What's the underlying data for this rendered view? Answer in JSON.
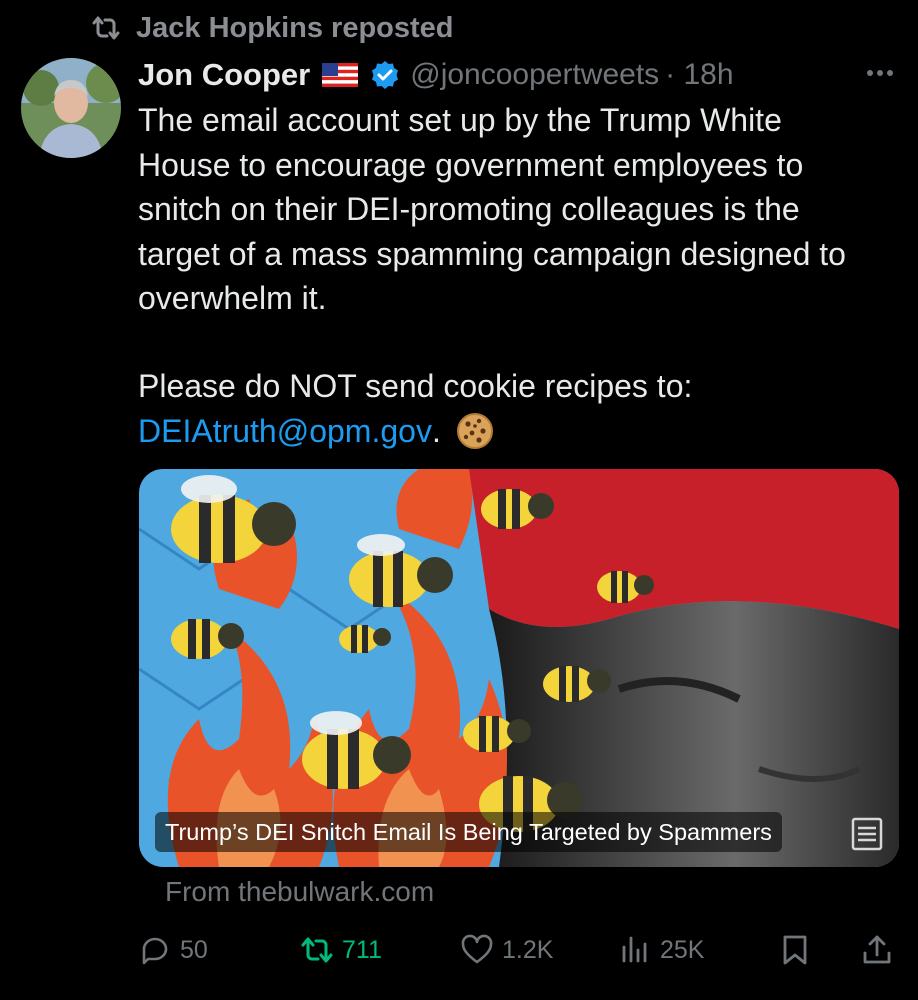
{
  "repost": {
    "icon": "repost-icon",
    "text": "Jack Hopkins reposted"
  },
  "author": {
    "name": "Jon Cooper",
    "flag_icon": "us-flag-icon",
    "verified_icon": "verified-badge-icon",
    "handle": "@joncoopertweets",
    "time": "· 18h"
  },
  "tweet": {
    "paragraph1": "The email account set up by the Trump White\nHouse to encourage government employees to\nsnitch on their DEI-promoting colleagues is the\ntarget of a mass spamming campaign designed to\noverwhelm it.",
    "paragraph2": "Please do NOT send cookie recipes to:",
    "email": "DEIAtruth@opm.gov",
    "email_suffix": ".",
    "emoji_icon": "cookie-emoji-icon"
  },
  "card": {
    "caption": "Trump’s DEI Snitch Email Is Being Targeted by Spammers",
    "source": "From thebulwark.com"
  },
  "actions": {
    "replies": "50",
    "reposts": "711",
    "likes": "1.2K",
    "views": "25K"
  },
  "colors": {
    "link": "#1d9bf0",
    "repost_active": "#00ba7c",
    "muted": "#71767b"
  }
}
